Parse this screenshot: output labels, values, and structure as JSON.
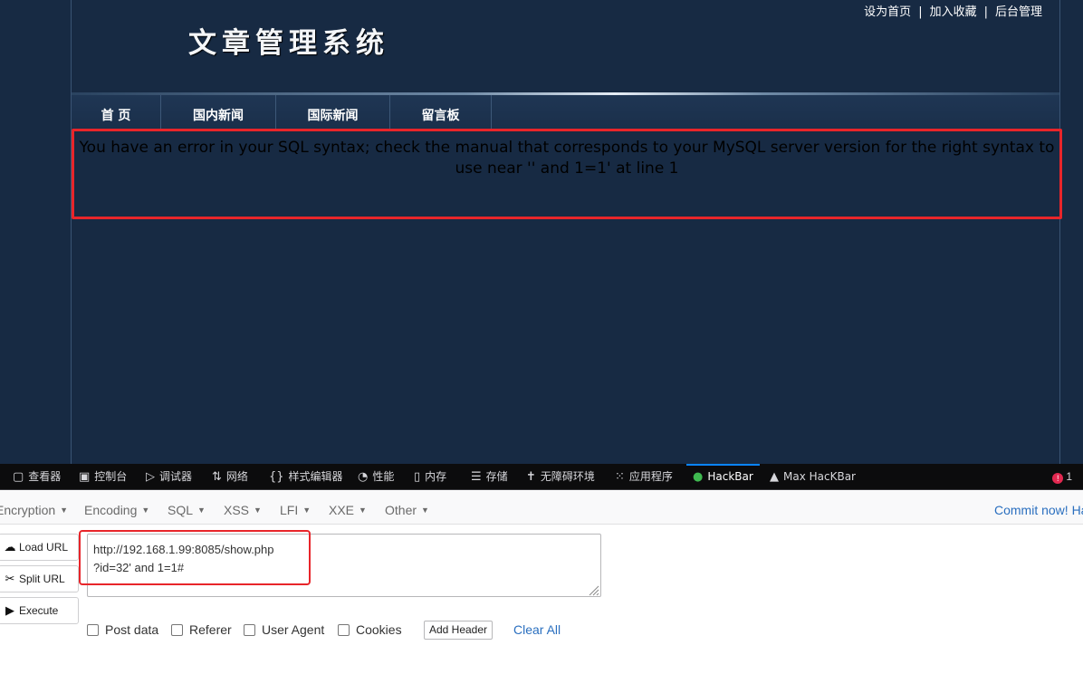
{
  "site": {
    "top_links": [
      "设为首页",
      "加入收藏",
      "后台管理"
    ],
    "title": "文章管理系统",
    "nav": [
      "首 页",
      "国内新闻",
      "国际新闻",
      "留言板"
    ],
    "error_message": "You have an error in your SQL syntax; check the manual that corresponds to your MySQL server version for the right syntax to use near '' and 1=1' at line 1"
  },
  "devtools": {
    "tabs": [
      {
        "label": "查看器",
        "icon": "inspector-icon"
      },
      {
        "label": "控制台",
        "icon": "console-icon"
      },
      {
        "label": "调试器",
        "icon": "debugger-icon"
      },
      {
        "label": "网络",
        "icon": "network-icon"
      },
      {
        "label": "样式编辑器",
        "icon": "style-editor-icon"
      },
      {
        "label": "性能",
        "icon": "performance-icon"
      },
      {
        "label": "内存",
        "icon": "memory-icon"
      },
      {
        "label": "存储",
        "icon": "storage-icon"
      },
      {
        "label": "无障碍环境",
        "icon": "accessibility-icon"
      },
      {
        "label": "应用程序",
        "icon": "application-icon"
      },
      {
        "label": "HackBar",
        "icon": "hackbar-icon",
        "active": true
      },
      {
        "label": "Max HacKBar",
        "icon": "max-hackbar-icon"
      }
    ],
    "error_count": "1"
  },
  "hackbar": {
    "menu": [
      "Encryption",
      "Encoding",
      "SQL",
      "XSS",
      "LFI",
      "XXE",
      "Other"
    ],
    "commit_link": "Commit now! Ha",
    "buttons": {
      "load_url": "Load URL",
      "split_url": "Split URL",
      "execute": "Execute"
    },
    "url_value": "http://192.168.1.99:8085/show.php\n?id=32' and 1=1#",
    "url_lines": [
      "http://192.168.1.99:8085/show.php",
      "?id=32' and 1=1#"
    ],
    "options": [
      "Post data",
      "Referer",
      "User Agent",
      "Cookies"
    ],
    "add_header": "Add Header",
    "clear_all": "Clear All"
  },
  "colors": {
    "page_bg": "#172a43",
    "highlight_red": "#e8252a",
    "link_blue": "#2a6fbf",
    "devtools_bg": "#0c0c0d",
    "active_tab_accent": "#0a84ff"
  }
}
